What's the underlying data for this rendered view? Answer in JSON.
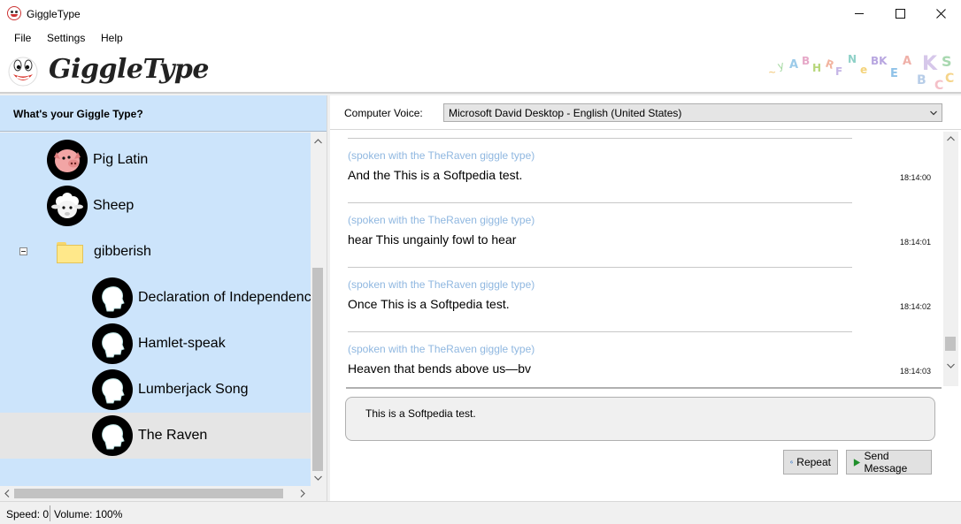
{
  "window": {
    "title": "GiggleType"
  },
  "menu": {
    "items": [
      "File",
      "Settings",
      "Help"
    ]
  },
  "banner": {
    "logo_text": "GiggleType"
  },
  "left_panel": {
    "header": "What's your Giggle Type?",
    "tree": [
      {
        "label": "Pig Latin",
        "icon": "pig-icon",
        "level": 1
      },
      {
        "label": "Sheep",
        "icon": "sheep-icon",
        "level": 1
      },
      {
        "label": "gibberish",
        "icon": "folder-icon",
        "level": 0,
        "expanded": true
      },
      {
        "label": "Declaration of Independence",
        "icon": "head-silhouette-icon",
        "level": 2
      },
      {
        "label": "Hamlet-speak",
        "icon": "head-silhouette-icon",
        "level": 2
      },
      {
        "label": "Lumberjack Song",
        "icon": "head-silhouette-icon",
        "level": 2
      },
      {
        "label": "The Raven",
        "icon": "head-silhouette-icon",
        "level": 2,
        "selected": true
      }
    ]
  },
  "voice": {
    "label": "Computer Voice:",
    "selected": "Microsoft David Desktop - English (United States)"
  },
  "messages": [
    {
      "tag": "(spoken with the TheRaven giggle type)",
      "text": "And the This is a Softpedia test.",
      "time": "18:14:00"
    },
    {
      "tag": "(spoken with the TheRaven giggle type)",
      "text": "hear This ungainly fowl to hear",
      "time": "18:14:01"
    },
    {
      "tag": "(spoken with the TheRaven giggle type)",
      "text": "Once This is a Softpedia test.",
      "time": "18:14:02"
    },
    {
      "tag": "(spoken with the TheRaven giggle type)",
      "text": "Heaven that bends above us—bv",
      "time": "18:14:03"
    }
  ],
  "input": {
    "value": "This is a Softpedia test."
  },
  "buttons": {
    "repeat": "Repeat",
    "send": "Send Message"
  },
  "status": {
    "speed": "Speed: 0",
    "volume": "Volume: 100%"
  },
  "colors": {
    "tree_bg": "#cce4fb",
    "tag_text": "#8fb7e0",
    "selected_row": "#e5e5e5"
  }
}
